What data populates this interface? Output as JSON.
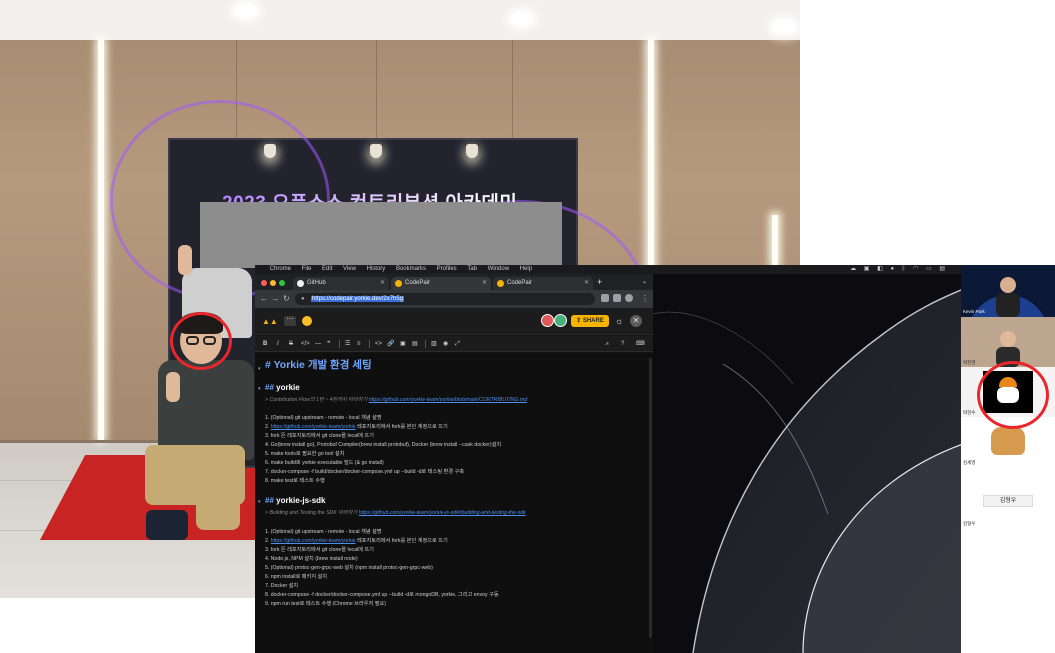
{
  "photo": {
    "banner_title": "2023 오픈소스 컨트리뷰션 아카데미"
  },
  "menubar": {
    "items": [
      "Chrome",
      "File",
      "Edit",
      "View",
      "History",
      "Bookmarks",
      "Profiles",
      "Tab",
      "Window",
      "Help"
    ]
  },
  "browser": {
    "tabs": [
      {
        "label": "GitHub",
        "icon": "github-icon"
      },
      {
        "label": "CodePair",
        "icon": "codepair-icon"
      },
      {
        "label": "CodePair",
        "icon": "codepair-icon"
      }
    ],
    "new_tab": "+",
    "url": "https://codepair.yorkie.dev/2x7h5g"
  },
  "app": {
    "share_label": "SHARE",
    "more_label": "⋯",
    "accent": "#f5b400"
  },
  "toolbar": {
    "items": [
      "B",
      "I",
      "S",
      "</>",
      "—",
      "❝",
      "☰",
      "≡",
      "<>",
      "🔗",
      "▣",
      "▤",
      "▥",
      "◉",
      "⤢"
    ]
  },
  "editor": {
    "h1": "Yorkie 개발 환경 세팅",
    "s1": {
      "heading": "yorkie",
      "quote_prefix": "> Contribution Flow의 1번 ~ 4번까지 따라하기",
      "quote_link": "https://github.com/yorkie-team/yorkie/blob/main/CONTRIBUTING.md",
      "items": [
        "1. (Optional) git upstream - remote - local 개념 설명",
        "2. https://github.com/yorkie-team/yorkie 레포지토리에서 fork를 본인 계정으로 뜨기",
        "3. fork 뜬 레포지토리에서 git clone을 local에 뜨기",
        "4. Go(brew install go), Protobuf Compiler(brew install protobuf), Docker (brew install --cask docker)설치",
        "5. make tools로 필요한 go tool 설치",
        "6. make build로 yorkie executable 빌드 (& go install)",
        "7. docker-compose -f build/docker/docker-compose.yml up --build -d로 테스팅 환경 구축",
        "8. make test로 테스트 수행"
      ]
    },
    "s2": {
      "heading": "yorkie-js-sdk",
      "quote_prefix": "> Building and Testing the SDK 따라하기",
      "quote_link": "https://github.com/yorkie-team/yorkie-js-sdk#building-and-testing-the-sdk",
      "items": [
        "1. (Optional) git upstream - remote - local 개념 설명",
        "2. https://github.com/yorkie-team/yorkie 레포지토리에서 fork를 본인 계정으로 뜨기",
        "3. fork 뜬 레포지토리에서 git clone을 local에 뜨기",
        "4. Node.js, NPM 설치 (brew install node)",
        "5. (Optional) protoc-gen-grpc-web 설치 (npm install protoc-gen-grpc-web)",
        "6. npm install로 패키지 설치",
        "7. Docker 설치",
        "8. docker-compose -f docker/docker-compose.yml up --build -d로 mongoDB, yorkie, 그리고 envoy 구동",
        "9. npm run test로 테스트 수행 (Chrome 브라우저 필요)"
      ]
    }
  },
  "participants": {
    "p1": "Kevin Park",
    "p2": "박진영",
    "p3": "박현수",
    "p4": "김세영",
    "center_name": "김형우",
    "p5": "김형우"
  }
}
